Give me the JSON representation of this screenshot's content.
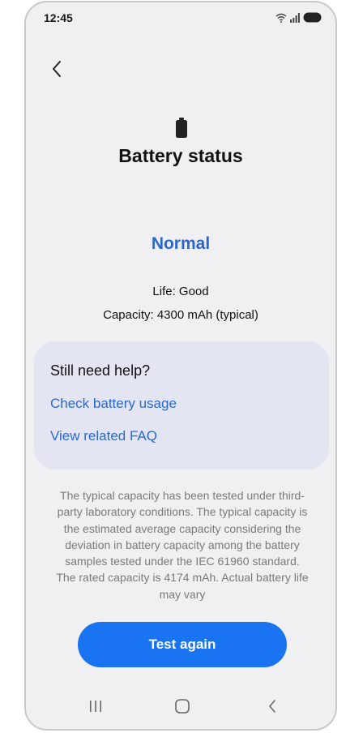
{
  "status_bar": {
    "time": "12:45"
  },
  "header": {
    "back_icon": "chevron-left-icon",
    "title": "Battery status",
    "battery_icon": "battery-icon"
  },
  "battery": {
    "status": "Normal",
    "life": "Life: Good",
    "capacity": "Capacity: 4300 mAh (typical)"
  },
  "help": {
    "title": "Still need help?",
    "links": [
      {
        "label": "Check battery usage"
      },
      {
        "label": "View related FAQ"
      }
    ]
  },
  "description": "The typical capacity has been tested under third-party laboratory conditions. The typical capacity is the estimated average capacity considering the deviation in battery capacity among the battery samples tested under the IEC 61960 standard. The rated capacity is 4174 mAh. Actual battery life may vary",
  "actions": {
    "test_again": "Test again"
  },
  "nav": {
    "recent_icon": "recent-apps-icon",
    "home_icon": "home-icon",
    "back_icon": "back-icon"
  },
  "colors": {
    "accent": "#2a67d0",
    "button": "#1a73f0",
    "background": "#f0f0f3",
    "card": "#e3e6f2"
  }
}
